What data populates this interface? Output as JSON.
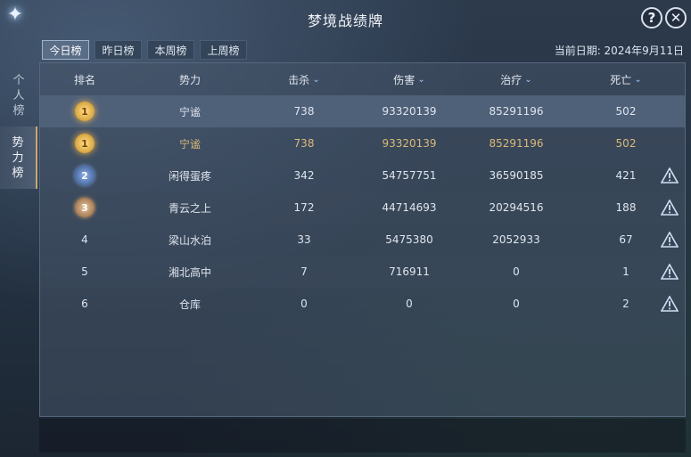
{
  "title": "梦境战绩牌",
  "tabs": [
    {
      "label": "今日榜",
      "active": true
    },
    {
      "label": "昨日榜",
      "active": false
    },
    {
      "label": "本周榜",
      "active": false
    },
    {
      "label": "上周榜",
      "active": false
    }
  ],
  "date_label": "当前日期: 2024年9月11日",
  "side_tabs": [
    {
      "label": "个\n人\n榜",
      "active": false
    },
    {
      "label": "势\n力\n榜",
      "active": true
    }
  ],
  "columns": {
    "rank": "排名",
    "power": "势力",
    "kill": "击杀",
    "damage": "伤害",
    "heal": "治疗",
    "death": "死亡"
  },
  "rows": [
    {
      "rank": "1",
      "power": "宁谧",
      "kill": "738",
      "damage": "93320139",
      "heal": "85291196",
      "death": "502"
    },
    {
      "rank": "1",
      "power": "宁谧",
      "kill": "738",
      "damage": "93320139",
      "heal": "85291196",
      "death": "502"
    },
    {
      "rank": "2",
      "power": "闲得蛋疼",
      "kill": "342",
      "damage": "54757751",
      "heal": "36590185",
      "death": "421"
    },
    {
      "rank": "3",
      "power": "青云之上",
      "kill": "172",
      "damage": "44714693",
      "heal": "20294516",
      "death": "188"
    },
    {
      "rank": "4",
      "power": "梁山水泊",
      "kill": "33",
      "damage": "5475380",
      "heal": "2052933",
      "death": "67"
    },
    {
      "rank": "5",
      "power": "湘北高中",
      "kill": "7",
      "damage": "716911",
      "heal": "0",
      "death": "1"
    },
    {
      "rank": "6",
      "power": "仓库",
      "kill": "0",
      "damage": "0",
      "heal": "0",
      "death": "2"
    }
  ],
  "icons": {
    "help": "?",
    "close": "✕",
    "star": "✦"
  },
  "colors": {
    "gold_text": "#d9b97a",
    "accent": "#9fc8ff"
  }
}
